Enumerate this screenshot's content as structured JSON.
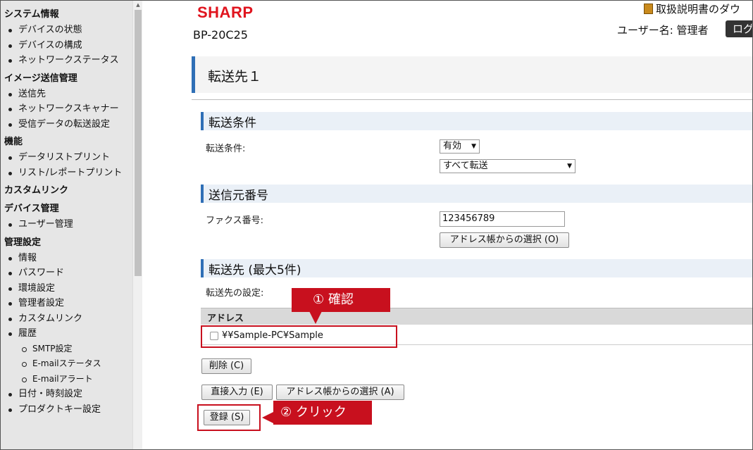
{
  "sidebar": {
    "sections": [
      {
        "title": "システム情報",
        "items": [
          "デバイスの状態",
          "デバイスの構成",
          "ネットワークステータス"
        ]
      },
      {
        "title": "イメージ送信管理",
        "items": [
          "送信先",
          "ネットワークスキャナー",
          "受信データの転送設定"
        ]
      },
      {
        "title": "機能",
        "items": [
          "データリストプリント",
          "リスト/レポートプリント"
        ]
      },
      {
        "title": "カスタムリンク",
        "items": []
      },
      {
        "title": "デバイス管理",
        "items": [
          "ユーザー管理"
        ]
      }
    ],
    "admin": {
      "title": "管理設定",
      "items_before": [
        "情報",
        "パスワード",
        "環境設定",
        "管理者設定",
        "カスタムリンク",
        "履歴"
      ],
      "sub_items": [
        "SMTP設定",
        "E-mailステータス",
        "E-mailアラート"
      ],
      "items_after": [
        "日付・時刻設定",
        "プロダクトキー設定"
      ]
    }
  },
  "header": {
    "logo": "SHARP",
    "model": "BP-20C25",
    "manual_link": "取扱説明書のダウ",
    "user_label": "ユーザー名: 管理者",
    "logout_label": "ログ"
  },
  "page": {
    "title": "転送先１",
    "transfer_condition": {
      "header": "転送条件",
      "label": "転送条件:",
      "status_value": "有効",
      "mode_value": "すべて転送"
    },
    "sender_number": {
      "header": "送信元番号",
      "label": "ファクス番号:",
      "fax_value": "123456789",
      "address_book_button": "アドレス帳からの選択 (O)"
    },
    "destination": {
      "header": "転送先 (最大5件)",
      "label": "転送先の設定:",
      "column_header": "アドレス",
      "rows": [
        "¥¥Sample-PC¥Sample"
      ],
      "delete_button": "削除 (C)",
      "direct_input_button": "直接入力 (E)",
      "address_book_button": "アドレス帳からの選択 (A)",
      "register_button": "登録 (S)"
    }
  },
  "annotations": {
    "confirm_label": "① 確認",
    "click_label": "② クリック",
    "color": "#c8101e"
  }
}
